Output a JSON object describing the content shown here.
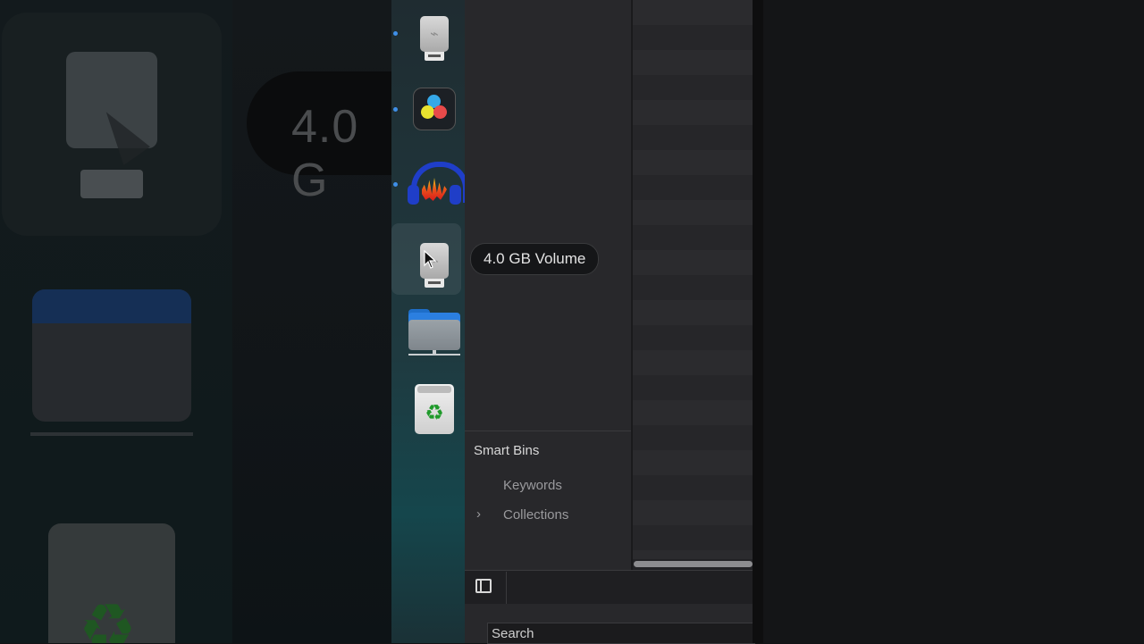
{
  "background": {
    "zoomed_label": "4.0 G"
  },
  "dock": {
    "items": [
      {
        "name": "usb-drive",
        "running": true
      },
      {
        "name": "davinci-resolve",
        "running": true
      },
      {
        "name": "audacity",
        "running": true
      },
      {
        "name": "usb-volume",
        "running": false,
        "hovered": true
      },
      {
        "name": "network-folder",
        "running": false
      },
      {
        "name": "trash",
        "running": false
      }
    ]
  },
  "tooltip": {
    "label": "4.0 GB Volume"
  },
  "sidebar": {
    "smart_bins_label": "Smart Bins",
    "items": [
      {
        "label": "Keywords",
        "expandable": false
      },
      {
        "label": "Collections",
        "expandable": true
      }
    ]
  },
  "search": {
    "placeholder": "Search"
  },
  "colors": {
    "indicator": "#3f8fe8",
    "panel_bg": "#28282b"
  }
}
